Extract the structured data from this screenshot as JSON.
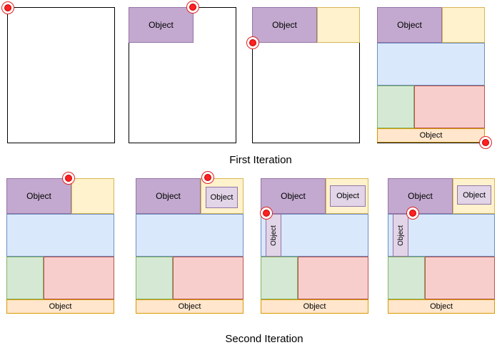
{
  "labels": {
    "object": "Object",
    "first_iteration": "First Iteration",
    "second_iteration": "Second Iteration"
  },
  "colors": {
    "purple_object": "#c3a9cf",
    "yellow_region": "#fff2cc",
    "blue_region": "#dae8fc",
    "green_region": "#d5e8d4",
    "red_region": "#f8cecc",
    "orange_bar": "#ffe6cc",
    "lilac_object": "#e1d5e7",
    "cursor": "#ff2020"
  },
  "icons": {
    "cursor": "placement-point-icon"
  }
}
